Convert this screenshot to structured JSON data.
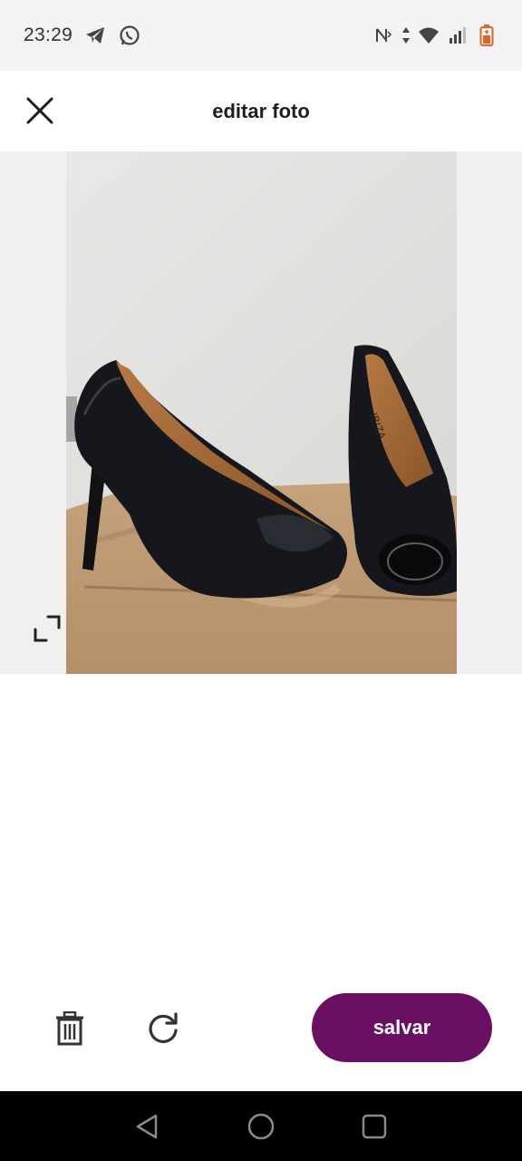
{
  "status_bar": {
    "time": "23:29",
    "icons": [
      "telegram-icon",
      "whatsapp-icon",
      "nfc-icon",
      "data-arrows-icon",
      "wifi-icon",
      "signal-icon",
      "battery-icon"
    ],
    "battery_color": "#e0642a"
  },
  "header": {
    "title": "editar foto",
    "close_icon": "close-icon"
  },
  "photo": {
    "expand_icon": "expand-icon"
  },
  "toolbar": {
    "delete_icon": "trash-icon",
    "rotate_icon": "rotate-icon",
    "save_label": "salvar",
    "save_color": "#6a0f62"
  },
  "nav": {
    "back_icon": "back-icon",
    "home_icon": "home-icon",
    "recents_icon": "recents-icon"
  }
}
